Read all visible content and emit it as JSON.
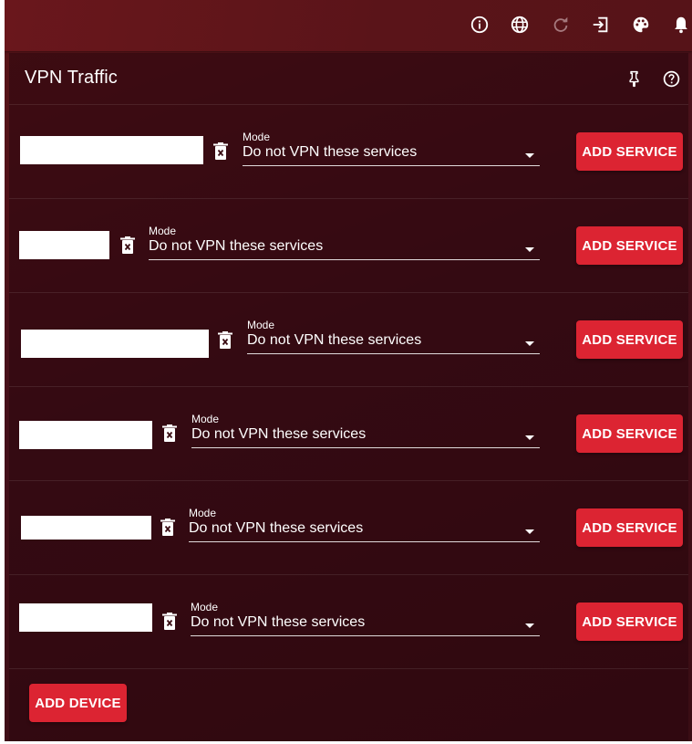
{
  "topbar": {
    "icons": [
      "info-icon",
      "globe-icon",
      "refresh-icon",
      "logout-icon",
      "palette-icon",
      "bell-icon"
    ]
  },
  "card": {
    "title": "VPN Traffic",
    "header_icons": [
      "pin-icon",
      "help-icon"
    ]
  },
  "devices": [
    {
      "name": "",
      "mode_label": "Mode",
      "mode_value": "Do not VPN these services",
      "add_service_label": "ADD SERVICE"
    },
    {
      "name": "",
      "mode_label": "Mode",
      "mode_value": "Do not VPN these services",
      "add_service_label": "ADD SERVICE"
    },
    {
      "name": "",
      "mode_label": "Mode",
      "mode_value": "Do not VPN these services",
      "add_service_label": "ADD SERVICE"
    },
    {
      "name": "",
      "mode_label": "Mode",
      "mode_value": "Do not VPN these services",
      "add_service_label": "ADD SERVICE"
    },
    {
      "name": "",
      "mode_label": "Mode",
      "mode_value": "Do not VPN these services",
      "add_service_label": "ADD SERVICE"
    },
    {
      "name": "",
      "mode_label": "Mode",
      "mode_value": "Do not VPN these services",
      "add_service_label": "ADD SERVICE"
    }
  ],
  "add_device_label": "ADD DEVICE",
  "colors": {
    "accent": "#dc2432",
    "background": "#44101a",
    "topbar": "#5a1419"
  }
}
